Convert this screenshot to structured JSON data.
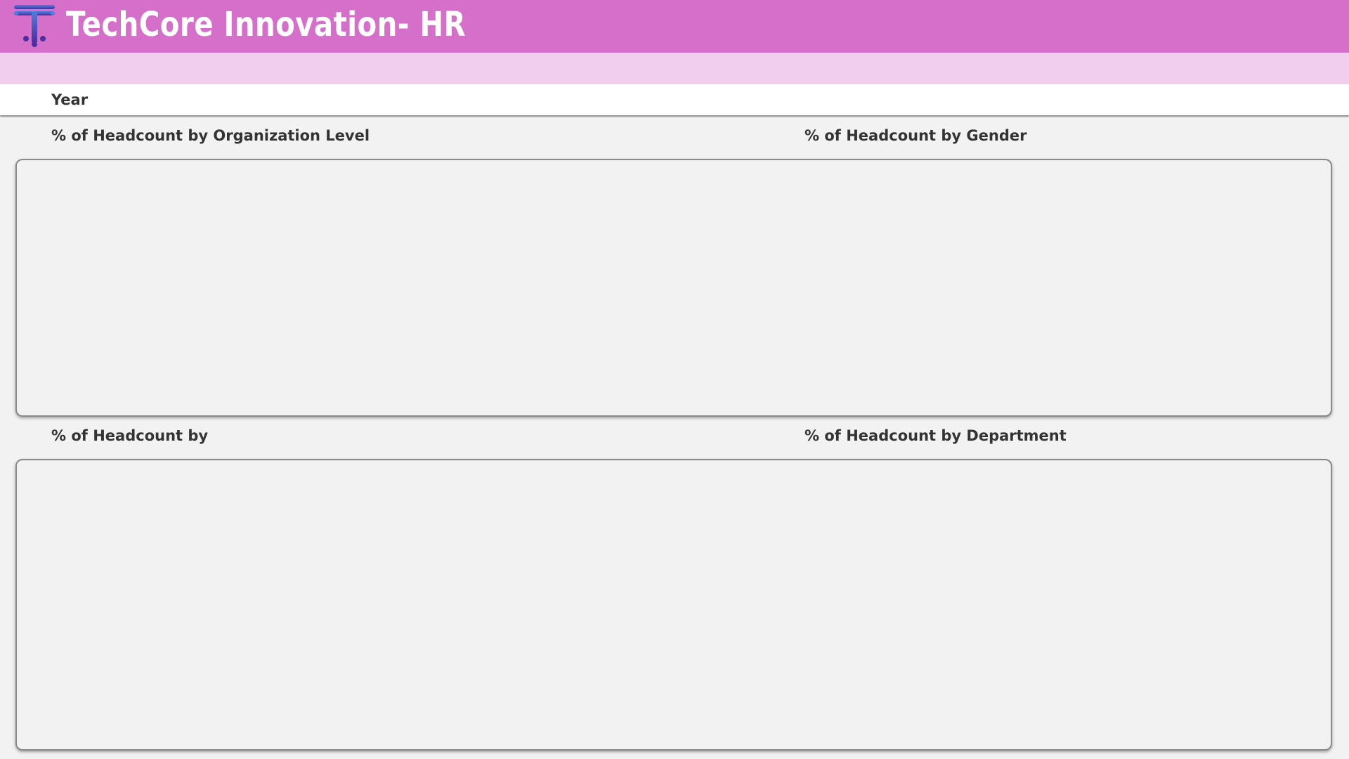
{
  "header": {
    "title": "TechCore Innovation- HR",
    "background_color": "#d66fc9",
    "logo_icon": "letter-t-circuit-logo"
  },
  "sub_band": {
    "color": "#f1ceee"
  },
  "filters": {
    "year_label": "Year"
  },
  "sections": {
    "org_level_title": "% of Headcount by Organization Level",
    "gender_title": "% of Headcount by Gender",
    "other_title": "% of Headcount by",
    "department_title": "% of Headcount by Department"
  }
}
